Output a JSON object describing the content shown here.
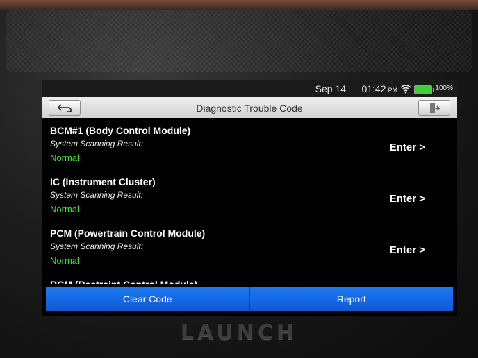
{
  "device": {
    "brand": "LAUNCH"
  },
  "status_bar": {
    "date": "Sep 14",
    "time": "01:42",
    "ampm": "PM",
    "battery_pct": "100%",
    "battery_color": "#3fd13a"
  },
  "header": {
    "title": "Diagnostic Trouble Code",
    "back_icon": "back-arrow-icon",
    "exit_icon": "exit-icon"
  },
  "modules": [
    {
      "name": "BCM#1 (Body Control Module)",
      "label": "System Scanning Result:",
      "result": "Normal",
      "action": "Enter >"
    },
    {
      "name": "IC (Instrument Cluster)",
      "label": "System Scanning Result:",
      "result": "Normal",
      "action": "Enter >"
    },
    {
      "name": "PCM (Powertrain Control Module)",
      "label": "System Scanning Result:",
      "result": "Normal",
      "action": "Enter >"
    },
    {
      "name": "RCM (Restraint Control Module)"
    }
  ],
  "footer": {
    "clear_label": "Clear Code",
    "report_label": "Report"
  },
  "colors": {
    "result_normal": "#3ee03a",
    "button_blue": "#1366e6"
  }
}
